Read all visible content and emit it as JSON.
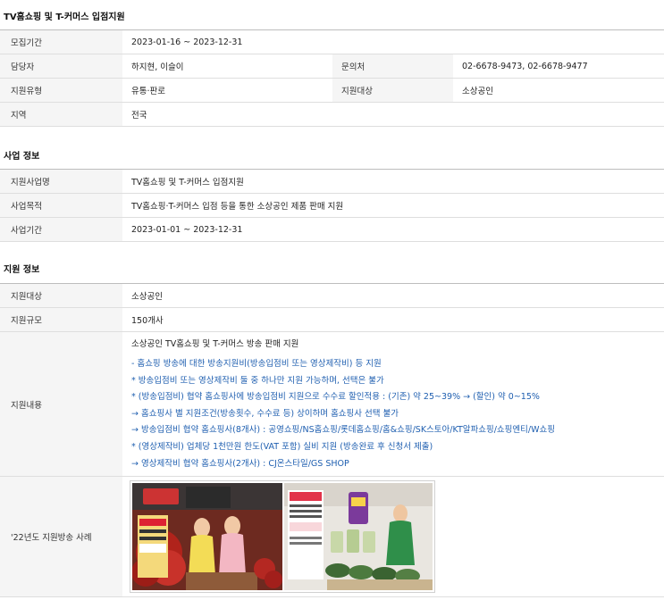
{
  "section1": {
    "title": "TV홈쇼핑 및 T-커머스 입점지원",
    "rows": {
      "period_label": "모집기간",
      "period_value": "2023-01-16 ~ 2023-12-31",
      "manager_label": "담당자",
      "manager_value": "하지현, 이슬이",
      "contact_label": "문의처",
      "contact_value": "02-6678-9473, 02-6678-9477",
      "type_label": "지원유형",
      "type_value": "유통·판로",
      "target_label": "지원대상",
      "target_value": "소상공인",
      "region_label": "지역",
      "region_value": "전국"
    }
  },
  "section2": {
    "title": "사업 정보",
    "rows": {
      "name_label": "지원사업명",
      "name_value": "TV홈쇼핑 및 T-커머스 입점지원",
      "purpose_label": "사업목적",
      "purpose_value": "TV홈쇼핑·T-커머스 입점 등을 통한 소상공인 제품 판매 지원",
      "duration_label": "사업기간",
      "duration_value": "2023-01-01 ~ 2023-12-31"
    }
  },
  "section3": {
    "title": "지원 정보",
    "rows": {
      "target_label": "지원대상",
      "target_value": "소상공인",
      "scale_label": "지원규모",
      "scale_value": "150개사",
      "content_label": "지원내용",
      "content_head": "소상공인 TV홈쇼핑 및 T-커머스 방송 판매 지원",
      "content_lines": [
        "- 홈쇼핑 방송에 대한 방송지원비(방송입점비 또는 영상제작비) 등 지원",
        "* 방송입점비 또는 영상제작비 둘 중 하나만 지원 가능하며, 선택은 불가",
        "* (방송입점비) 협약 홈쇼핑사에 방송입점비 지원으로 수수료 할인적용 : (기존) 약 25~39% → (할인) 약 0~15%",
        "→ 홈쇼핑사 별 지원조건(방송횟수, 수수료 등) 상이하며 홈쇼핑사 선택 불가",
        "→ 방송입점비 협약 홈쇼핑사(8개사) : 공영쇼핑/NS홈쇼핑/롯데홈쇼핑/홈&쇼핑/SK스토아/KT알파쇼핑/쇼핑엔티/W쇼핑",
        "* (영상제작비) 업체당 1천만원 한도(VAT 포함) 실비 지원 (방송완료 후 신청서 제출)",
        "→ 영상제작비 협약 홈쇼핑사(2개사) : CJ온스타일/GS SHOP"
      ],
      "case_label": "'22년도 지원방송 사례"
    }
  },
  "colors": {
    "accent_blue": "#1f5fb0",
    "header_bg": "#f5f5f5",
    "border": "#dedede"
  }
}
